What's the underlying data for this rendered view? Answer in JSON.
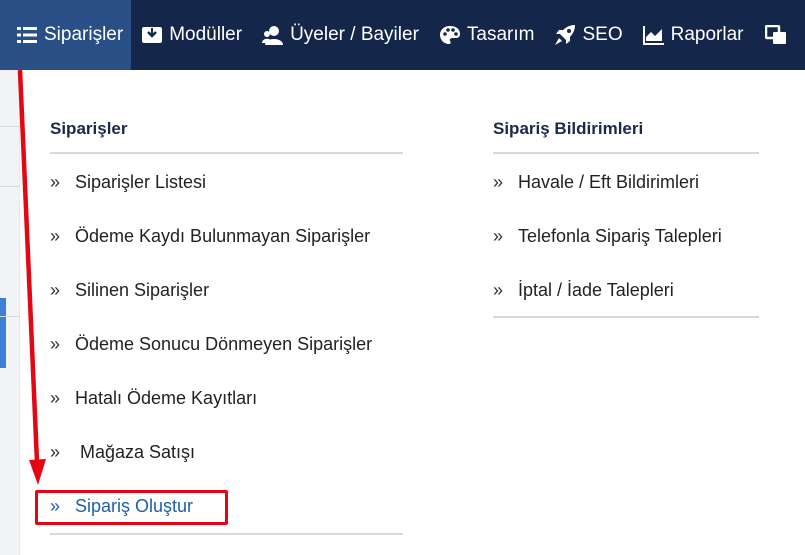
{
  "topnav": {
    "items": [
      {
        "label": "Siparişler",
        "icon": "list-icon"
      },
      {
        "label": "Modüller",
        "icon": "inbox-icon"
      },
      {
        "label": "Üyeler / Bayiler",
        "icon": "users-icon"
      },
      {
        "label": "Tasarım",
        "icon": "palette-icon"
      },
      {
        "label": "SEO",
        "icon": "rocket-icon"
      },
      {
        "label": "Raporlar",
        "icon": "chart-icon"
      }
    ],
    "overflow_icon": "copy-icon"
  },
  "dropdown": {
    "left_column": {
      "title": "Siparişler",
      "items": [
        "Siparişler Listesi",
        "Ödeme Kaydı Bulunmayan Siparişler",
        "Silinen Siparişler",
        "Ödeme Sonucu Dönmeyen Siparişler",
        "Hatalı Ödeme Kayıtları",
        " Mağaza Satışı",
        "Sipariş Oluştur"
      ],
      "highlighted_item": "Sipariş Oluştur"
    },
    "right_column": {
      "title": "Sipariş Bildirimleri",
      "items": [
        "Havale / Eft Bildirimleri",
        "Telefonla Sipariş Talepleri",
        "İptal / İade Talepleri"
      ]
    },
    "chevron_glyph": "»"
  },
  "colors": {
    "nav_bg": "#14264a",
    "nav_active_bg": "#2a4f86",
    "annotation": "#e30613",
    "link_highlight": "#1f5fa8"
  }
}
